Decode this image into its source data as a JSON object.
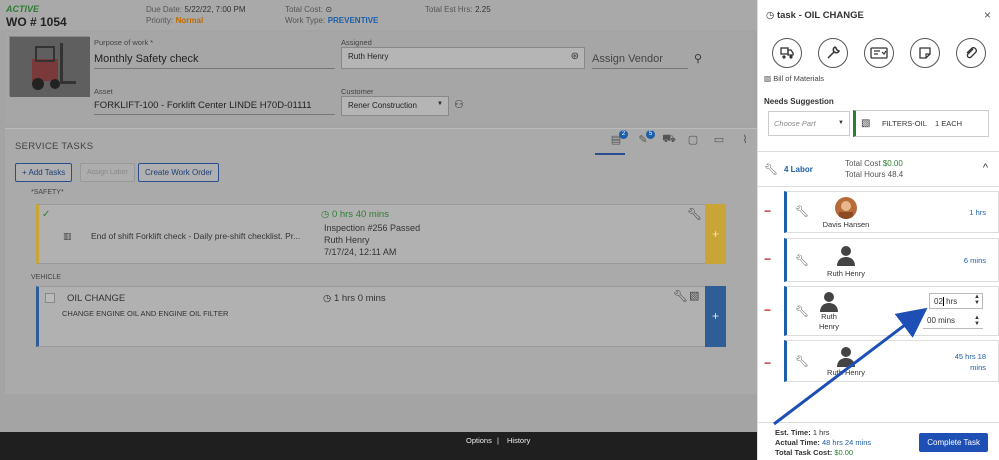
{
  "work_order": {
    "status": "ACTIVE",
    "number": "WO # 1054",
    "due_date_label": "Due Date:",
    "due_date": "5/22/22, 7:00 PM",
    "priority_label": "Priority:",
    "priority": "Normal",
    "total_cost_label": "Total Cost:",
    "work_type_label": "Work Type:",
    "work_type": "PREVENTIVE",
    "total_est_label": "Total Est Hrs:",
    "total_est": "2.25",
    "purpose_label": "Purpose of work *",
    "purpose": "Monthly Safety check",
    "assigned_label": "Assigned",
    "assigned": "Ruth Henry",
    "vendor_placeholder": "Assign Vendor",
    "asset_label": "Asset",
    "asset": "FORKLIFT-100 -  Forklift Center LINDE H70D-01111",
    "customer_label": "Customer",
    "customer": "Rener Construction"
  },
  "service_tasks": {
    "title": "SERVICE TASKS",
    "add_tasks": "+ Add Tasks",
    "assign_labor": "Assign Labor",
    "create_wo": "Create Work Order",
    "tab_badges": [
      "2",
      "5"
    ],
    "group_safety": "*SAFETY*",
    "task1": {
      "text": "End of shift Forklift check - Daily pre-shift checklist. Pr...",
      "time": "0 hrs 40 mins",
      "inspection": "Inspection #256 Passed",
      "person": "Ruth Henry",
      "date": "7/17/24, 12:11 AM",
      "plus": "+"
    },
    "group_vehicle": "VEHICLE",
    "task2": {
      "title": "OIL CHANGE",
      "desc": "CHANGE ENGINE OIL AND ENGINE OIL FILTER",
      "time": "1 hrs 0 mins",
      "plus": "+"
    }
  },
  "bottom_bar": {
    "options": "Options",
    "separator": "|",
    "history": "History"
  },
  "drawer": {
    "title": "task - OIL CHANGE",
    "close": "×",
    "bill_of_materials": "Bill of Materials",
    "needs_suggestion": "Needs Suggestion",
    "choose_part": "Choose Part",
    "part_name": "FILTERS-OIL",
    "part_qty": "1 EACH",
    "labor_count": "4 Labor",
    "total_cost_label": "Total Cost",
    "total_cost": "$0.00",
    "total_hours": "Total Hours 48.4",
    "labor": [
      {
        "name": "Davis Hansen",
        "hours": "1 hrs"
      },
      {
        "name": "Ruth Henry",
        "hours": "6 mins"
      },
      {
        "name_line1": "Ruth",
        "name_line2": "Henry",
        "hrs_value": "02",
        "hrs_unit": "hrs",
        "mins_value": "00 mins"
      },
      {
        "name": "Ruth Henry",
        "hours_line1": "45 hrs 18",
        "hours_line2": "mins"
      }
    ],
    "minus": "−",
    "est_time_label": "Est. Time:",
    "est_time": "1 hrs",
    "actual_time_label": "Actual Time:",
    "actual_time": "48 hrs 24 mins",
    "total_task_cost_label": "Total Task Cost:",
    "total_task_cost": "$0.00",
    "complete_task": "Complete Task"
  },
  "colors": {
    "accent": "#1d4fb4",
    "green": "#2e7d32",
    "danger": "#c62828",
    "warning": "#c9a437"
  }
}
